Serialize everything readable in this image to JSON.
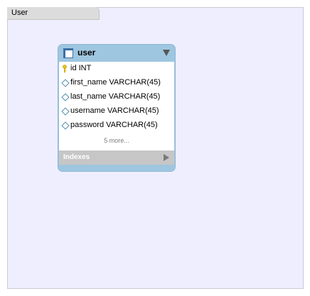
{
  "layer": {
    "title": "User"
  },
  "table": {
    "name": "user",
    "columns": [
      {
        "label": "id INT",
        "icon": "primary-key-icon"
      },
      {
        "label": "first_name VARCHAR(45)",
        "icon": "column-diamond-icon"
      },
      {
        "label": "last_name VARCHAR(45)",
        "icon": "column-diamond-icon"
      },
      {
        "label": "username VARCHAR(45)",
        "icon": "column-diamond-icon"
      },
      {
        "label": "password VARCHAR(45)",
        "icon": "column-diamond-icon"
      }
    ],
    "more_label": "5 more...",
    "indexes_label": "Indexes"
  },
  "colors": {
    "canvas": "#eeeeff",
    "table_header": "#9fc6e0",
    "indexes_bar": "#c6c6c6",
    "key": "#e8c21a"
  }
}
